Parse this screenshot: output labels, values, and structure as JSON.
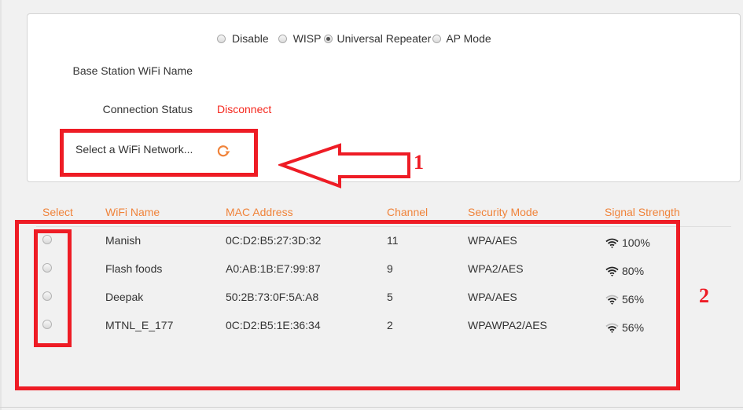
{
  "mode_selector": {
    "options": [
      {
        "label": "Disable",
        "checked": false
      },
      {
        "label": "WISP",
        "checked": false
      },
      {
        "label": "Universal Repeater",
        "checked": true
      },
      {
        "label": "AP Mode",
        "checked": false
      }
    ]
  },
  "form": {
    "base_station_label": "Base Station WiFi Name",
    "base_station_value": "",
    "connection_status_label": "Connection Status",
    "connection_status_value": "Disconnect",
    "select_network_label": "Select a WiFi Network...",
    "refresh_icon": "refresh-icon"
  },
  "annotations": {
    "arrow_number": "1",
    "table_number": "2",
    "color": "#ee1c25"
  },
  "table": {
    "headers": [
      "Select",
      "WiFi Name",
      "MAC Address",
      "Channel",
      "Security Mode",
      "Signal Strength"
    ],
    "rows": [
      {
        "name": "Manish",
        "mac": "0C:D2:B5:27:3D:32",
        "channel": "11",
        "security": "WPA/AES",
        "signal": "100%",
        "signal_level": 4
      },
      {
        "name": "Flash foods",
        "mac": "A0:AB:1B:E7:99:87",
        "channel": "9",
        "security": "WPA2/AES",
        "signal": "80%",
        "signal_level": 4
      },
      {
        "name": "Deepak",
        "mac": "50:2B:73:0F:5A:A8",
        "channel": "5",
        "security": "WPA/AES",
        "signal": "56%",
        "signal_level": 3
      },
      {
        "name": "MTNL_E_177",
        "mac": "0C:D2:B5:1E:36:34",
        "channel": "2",
        "security": "WPAWPA2/AES",
        "signal": "56%",
        "signal_level": 3
      }
    ]
  },
  "colors": {
    "header_accent": "#f0833a",
    "status_error": "#f5281e"
  }
}
